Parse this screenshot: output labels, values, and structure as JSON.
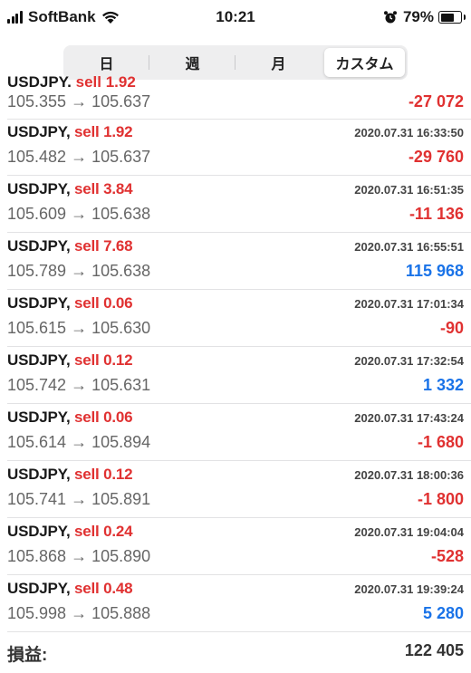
{
  "status_bar": {
    "carrier": "SoftBank",
    "time": "10:21",
    "battery_percent": "79%",
    "battery_level": 0.79
  },
  "segmented": {
    "items": [
      "日",
      "週",
      "月",
      "カスタム"
    ],
    "selected": "カスタム"
  },
  "first_row": {
    "prices": "105.355 → 105.637",
    "profit": "-27 072"
  },
  "trades": [
    {
      "symbol": "USDJPY,",
      "side": "sell 1.92",
      "time": "2020.07.31 16:33:50",
      "prices": "105.482 → 105.637",
      "profit": "-29 760",
      "sign": "neg"
    },
    {
      "symbol": "USDJPY,",
      "side": "sell 3.84",
      "time": "2020.07.31 16:51:35",
      "prices": "105.609 → 105.638",
      "profit": "-11 136",
      "sign": "neg"
    },
    {
      "symbol": "USDJPY,",
      "side": "sell 7.68",
      "time": "2020.07.31 16:55:51",
      "prices": "105.789 → 105.638",
      "profit": "115 968",
      "sign": "pos"
    },
    {
      "symbol": "USDJPY,",
      "side": "sell 0.06",
      "time": "2020.07.31 17:01:34",
      "prices": "105.615 → 105.630",
      "profit": "-90",
      "sign": "neg"
    },
    {
      "symbol": "USDJPY,",
      "side": "sell 0.12",
      "time": "2020.07.31 17:32:54",
      "prices": "105.742 → 105.631",
      "profit": "1 332",
      "sign": "pos"
    },
    {
      "symbol": "USDJPY,",
      "side": "sell 0.06",
      "time": "2020.07.31 17:43:24",
      "prices": "105.614 → 105.894",
      "profit": "-1 680",
      "sign": "neg"
    },
    {
      "symbol": "USDJPY,",
      "side": "sell 0.12",
      "time": "2020.07.31 18:00:36",
      "prices": "105.741 → 105.891",
      "profit": "-1 800",
      "sign": "neg"
    },
    {
      "symbol": "USDJPY,",
      "side": "sell 0.24",
      "time": "2020.07.31 19:04:04",
      "prices": "105.868 → 105.890",
      "profit": "-528",
      "sign": "neg"
    },
    {
      "symbol": "USDJPY,",
      "side": "sell 0.48",
      "time": "2020.07.31 19:39:24",
      "prices": "105.998 → 105.888",
      "profit": "5 280",
      "sign": "pos"
    }
  ],
  "summary": {
    "label": "損益:",
    "value": "122 405"
  },
  "colors": {
    "negative": "#e03131",
    "positive": "#1a73e8",
    "sell": "#e03131"
  }
}
